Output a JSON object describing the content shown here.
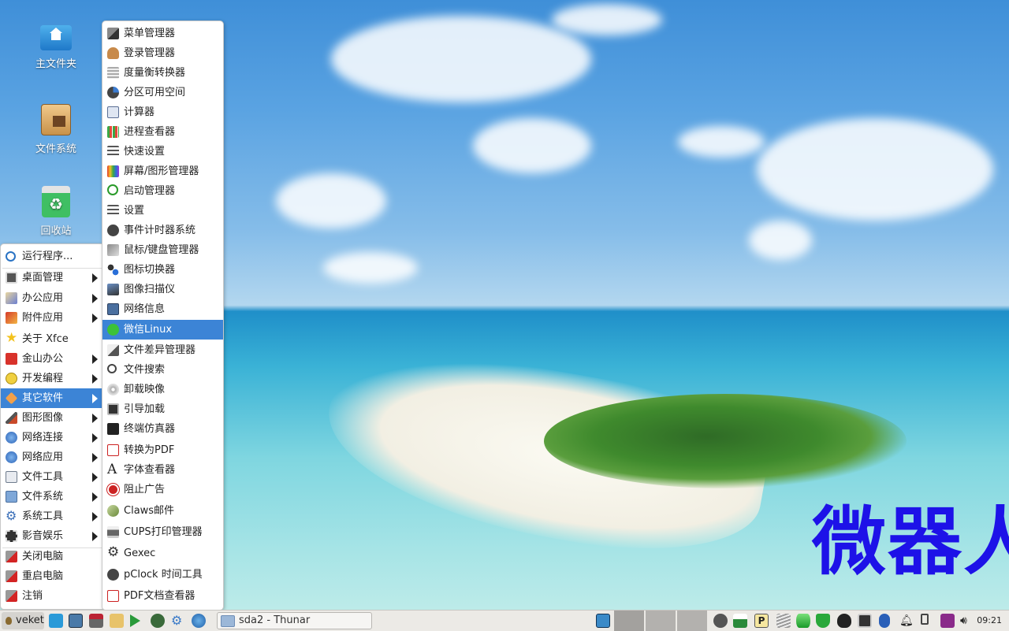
{
  "desktop": {
    "icons": [
      {
        "label": "主文件夹",
        "icon": "home-folder-icon"
      },
      {
        "label": "文件系统",
        "icon": "filesystem-icon"
      },
      {
        "label": "回收站",
        "icon": "trash-icon"
      }
    ],
    "watermark": "微器人"
  },
  "main_menu": {
    "items": [
      {
        "label": "运行程序...",
        "icon": "search-icon",
        "submenu": false
      },
      {
        "label": "桌面管理",
        "icon": "desktop-icon",
        "submenu": true
      },
      {
        "label": "办公应用",
        "icon": "office-icon",
        "submenu": true
      },
      {
        "label": "附件应用",
        "icon": "accessories-icon",
        "submenu": true
      },
      {
        "label": "关于 Xfce",
        "icon": "star-icon",
        "submenu": false
      },
      {
        "label": "金山办公",
        "icon": "wps-icon",
        "submenu": true
      },
      {
        "label": "开发编程",
        "icon": "development-icon",
        "submenu": true
      },
      {
        "label": "其它软件",
        "icon": "other-icon",
        "submenu": true,
        "selected": true
      },
      {
        "label": "图形图像",
        "icon": "graphics-icon",
        "submenu": true
      },
      {
        "label": "网络连接",
        "icon": "network-icon",
        "submenu": true
      },
      {
        "label": "网络应用",
        "icon": "internet-icon",
        "submenu": true
      },
      {
        "label": "文件工具",
        "icon": "file-tools-icon",
        "submenu": true
      },
      {
        "label": "文件系统",
        "icon": "folder-icon",
        "submenu": true
      },
      {
        "label": "系统工具",
        "icon": "system-tools-icon",
        "submenu": true
      },
      {
        "label": "影音娱乐",
        "icon": "multimedia-icon",
        "submenu": true
      },
      {
        "label": "关闭电脑",
        "icon": "shutdown-icon",
        "submenu": false
      },
      {
        "label": "重启电脑",
        "icon": "reboot-icon",
        "submenu": false
      },
      {
        "label": "注销",
        "icon": "logout-icon",
        "submenu": false
      }
    ]
  },
  "sub_menu": {
    "items": [
      {
        "label": "菜单管理器",
        "icon": "menu-editor-icon"
      },
      {
        "label": "登录管理器",
        "icon": "login-manager-icon"
      },
      {
        "label": "度量衡转换器",
        "icon": "converter-icon"
      },
      {
        "label": "分区可用空间",
        "icon": "disk-usage-icon"
      },
      {
        "label": "计算器",
        "icon": "calculator-icon"
      },
      {
        "label": "进程查看器",
        "icon": "process-viewer-icon"
      },
      {
        "label": "快速设置",
        "icon": "quick-settings-icon"
      },
      {
        "label": "屏幕/图形管理器",
        "icon": "display-manager-icon"
      },
      {
        "label": "启动管理器",
        "icon": "power-icon"
      },
      {
        "label": "设置",
        "icon": "settings-icon"
      },
      {
        "label": "事件计时器系统",
        "icon": "timer-icon"
      },
      {
        "label": "鼠标/键盘管理器",
        "icon": "mouse-keyboard-icon"
      },
      {
        "label": "图标切换器",
        "icon": "icon-switcher-icon"
      },
      {
        "label": "图像扫描仪",
        "icon": "scanner-icon"
      },
      {
        "label": "网络信息",
        "icon": "network-info-icon"
      },
      {
        "label": "微信Linux",
        "icon": "wechat-icon",
        "selected": true
      },
      {
        "label": "文件差异管理器",
        "icon": "diff-icon"
      },
      {
        "label": "文件搜索",
        "icon": "search-icon"
      },
      {
        "label": "卸载映像",
        "icon": "unmount-icon"
      },
      {
        "label": "引导加载",
        "icon": "bootloader-icon"
      },
      {
        "label": "终端仿真器",
        "icon": "terminal-icon"
      },
      {
        "label": "转换为PDF",
        "icon": "pdf-icon"
      },
      {
        "label": "字体查看器",
        "icon": "font-icon"
      },
      {
        "label": "阻止广告",
        "icon": "adblock-icon"
      },
      {
        "label": "Claws邮件",
        "icon": "mail-icon"
      },
      {
        "label": "CUPS打印管理器",
        "icon": "printer-icon"
      },
      {
        "label": "Gexec",
        "icon": "gear-icon"
      },
      {
        "label": "pClock 时间工具",
        "icon": "clock-icon"
      },
      {
        "label": "PDF文档查看器",
        "icon": "pdf-viewer-icon"
      }
    ]
  },
  "taskbar": {
    "start_label": "veket",
    "task_label": "sda2 - Thunar",
    "clock": "09:21"
  }
}
